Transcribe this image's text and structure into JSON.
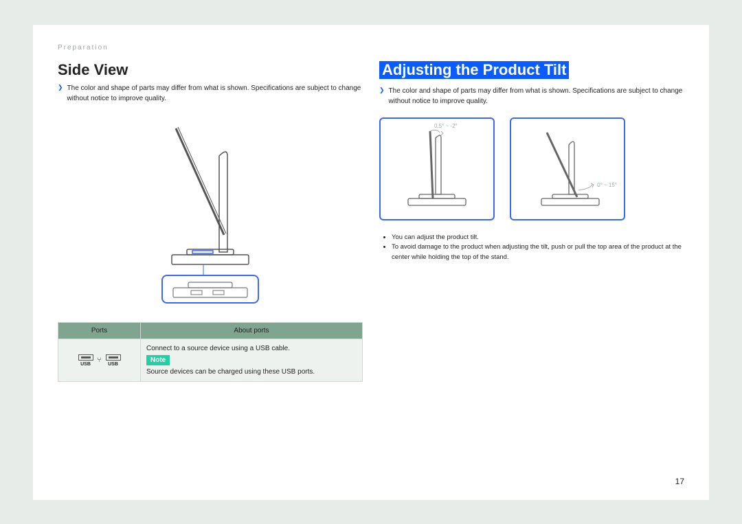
{
  "breadcrumb": "Preparation",
  "page_number": "17",
  "left": {
    "heading": "Side View",
    "disclaimer": "The color and shape of parts may differ from what is shown. Specifications are subject to change without notice to improve quality.",
    "table": {
      "head_ports": "Ports",
      "head_about": "About ports",
      "usb_label": "USB",
      "connect_text": "Connect to a source device using a USB cable.",
      "note_chip": "Note",
      "note_text": "Source devices can be charged using these USB ports."
    }
  },
  "right": {
    "heading": "Adjusting the Product Tilt",
    "disclaimer": "The color and shape of parts may differ from what is shown. Specifications are subject to change without notice to improve quality.",
    "angle1": "0.5° ~ -2°",
    "angle2": "0° ~ 15°",
    "tips": [
      "You can adjust the product tilt.",
      "To avoid damage to the product when adjusting the tilt, push or pull the top area of the product at the center while holding the top of the stand."
    ]
  }
}
